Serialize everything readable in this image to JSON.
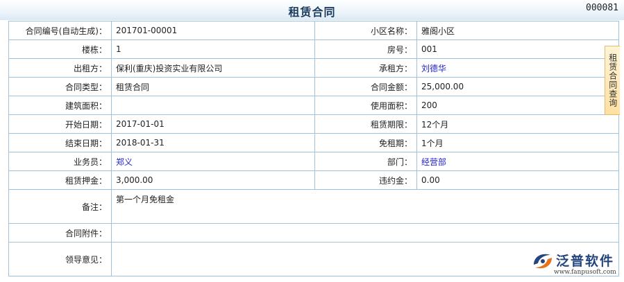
{
  "header": {
    "title": "租赁合同",
    "form_number": "000081"
  },
  "side_tab": {
    "label": "租赁合同查询"
  },
  "fields": {
    "contract_no_label": "合同编号(自动生成)：",
    "contract_no": "201701-00001",
    "community_label": "小区名称：",
    "community": "雅阁小区",
    "building_label": "楼栋：",
    "building": "1",
    "room_label": "房号：",
    "room": "001",
    "lessor_label": "出租方：",
    "lessor": "保利(重庆)投资实业有限公司",
    "lessee_label": "承租方：",
    "lessee": "刘德华",
    "contract_type_label": "合同类型：",
    "contract_type": "租赁合同",
    "amount_label": "合同金额：",
    "amount": "25,000.00",
    "floor_area_label": "建筑面积：",
    "floor_area": "",
    "usable_area_label": "使用面积：",
    "usable_area": "200",
    "start_date_label": "开始日期：",
    "start_date": "2017-01-01",
    "term_label": "租赁期限：",
    "term": "12个月",
    "end_date_label": "结束日期：",
    "end_date": "2018-01-31",
    "free_period_label": "免租期：",
    "free_period": "1个月",
    "salesperson_label": "业务员：",
    "salesperson": "郑义",
    "department_label": "部门：",
    "department": "经营部",
    "deposit_label": "租赁押金：",
    "deposit": "3,000.00",
    "penalty_label": "违约金：",
    "penalty": "0.00",
    "remarks_label": "备注：",
    "remarks": "第一个月免租金",
    "attachments_label": "合同附件：",
    "attachments": "",
    "leader_opinion_label": "领导意见：",
    "leader_opinion": ""
  },
  "logo": {
    "brand": "泛普软件",
    "url": "www.fanpusoft.com"
  },
  "colors": {
    "border": "#9fc3de",
    "link": "#2323c8",
    "title": "#1b3a5c",
    "side_tab_bg": "#ffe0a3",
    "brand": "#25457e",
    "logo_accent": "#e8731a"
  }
}
